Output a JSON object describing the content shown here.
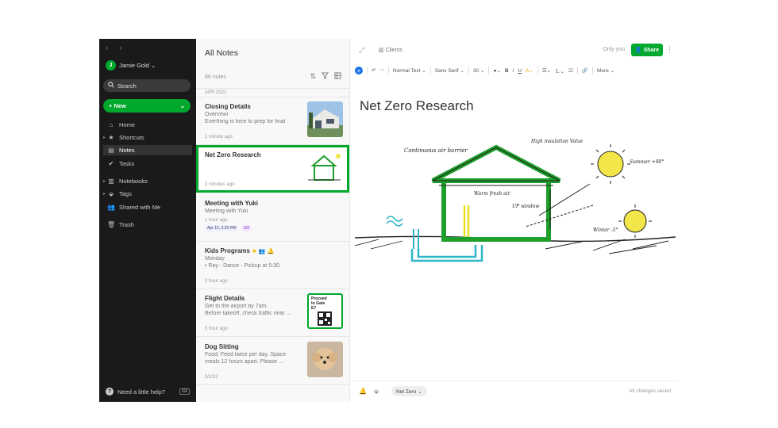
{
  "sidebar": {
    "nav_arrows": "‹  ›",
    "user": {
      "initial": "J",
      "name": "Jamie Gold ⌄"
    },
    "search_label": "Search",
    "new_label": "+ New",
    "new_chevron": "⌄",
    "items": [
      {
        "label": "Home",
        "icon": "home-icon"
      },
      {
        "label": "Shortcuts",
        "icon": "star-icon"
      },
      {
        "label": "Notes",
        "icon": "notes-icon"
      },
      {
        "label": "Tasks",
        "icon": "tasks-icon"
      },
      {
        "label": "Notebooks",
        "icon": "notebook-icon"
      },
      {
        "label": "Tags",
        "icon": "tag-icon"
      },
      {
        "label": "Shared with Me",
        "icon": "people-icon"
      },
      {
        "label": "Trash",
        "icon": "trash-icon"
      }
    ],
    "help_label": "Need a little help?"
  },
  "notes_list": {
    "title": "All Notes",
    "count": "86 notes",
    "month": "APR 2022",
    "notes": [
      {
        "title": "Closing Details",
        "lines": [
          "Overvewi",
          "Everthing is here to prep for final"
        ],
        "time": "1 minute ago"
      },
      {
        "title": "Net Zero Research",
        "lines": [],
        "time": "3 minutes ago"
      },
      {
        "title": "Meeting with Yuki",
        "lines": [
          "Meeting with Yuki"
        ],
        "time": "1 hour ago",
        "badges": [
          "Apr 16, 3:30 PM",
          "0/2"
        ]
      },
      {
        "title": "Kids Programs",
        "lines": [
          "Monday",
          "• Ray - Dance - Pickup at 5:30."
        ],
        "time": "2 hour ago"
      },
      {
        "title": "Flight Details",
        "lines": [
          "Get to the airport by 7am.",
          "Before takeoff, check traffic near ..."
        ],
        "time": "5 hour ago"
      },
      {
        "title": "Dog Sitting",
        "lines": [
          "Food: Feed twice per day. Space",
          "meals 12 hours apart. Please ..."
        ],
        "time": "3/2/22"
      }
    ],
    "boarding_pass_text": "Proceed to Gate E7"
  },
  "editor": {
    "notebook": "Clients",
    "visibility": "Only you",
    "share_label": "Share",
    "toolbar": {
      "style": "Normal Text ⌄",
      "font": "Sans Serif ⌄",
      "size": "30 ⌄",
      "more": "More ⌄"
    },
    "title": "Net Zero Research",
    "sketch_labels": {
      "air_barrier": "Continuous air barrier",
      "insulation": "High insulation Value",
      "summer": "Summer +90°",
      "winter": "Winter -5°",
      "warm_air": "Warm fresh air",
      "window": "UP window"
    },
    "tag": "Net Zero ⌄",
    "status": "All changes saved"
  },
  "colors": {
    "accent": "#00a82d",
    "sidebar_bg": "#1a1a1a",
    "link_blue": "#1a73e8"
  }
}
